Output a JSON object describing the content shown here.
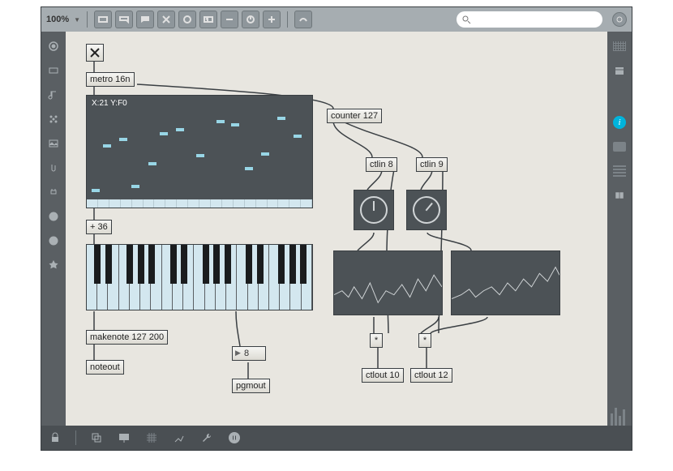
{
  "toolbar": {
    "zoom": "100%",
    "search_placeholder": ""
  },
  "patch": {
    "metro": "metro 16n",
    "multislider_label": "X:21 Y:F0",
    "plus36": "+ 36",
    "makenote": "makenote 127 200",
    "noteout": "noteout",
    "numbox8": "8",
    "pgmout": "pgmout",
    "counter": "counter 127",
    "ctlin8": "ctlin 8",
    "ctlin9": "ctlin 9",
    "star1": "*",
    "star2": "*",
    "ctlout10": "ctlout 10",
    "ctlout12": "ctlout 12"
  }
}
